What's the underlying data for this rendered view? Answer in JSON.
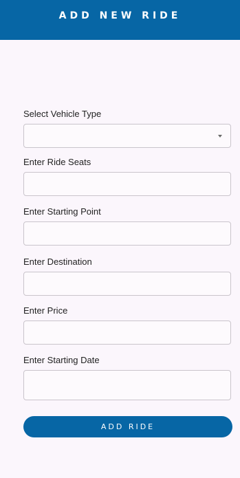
{
  "app_bar": {
    "title": "ADD NEW RIDE"
  },
  "form": {
    "vehicle_type": {
      "label": "Select Vehicle Type",
      "value": ""
    },
    "ride_seats": {
      "label": "Enter Ride Seats",
      "value": ""
    },
    "starting_point": {
      "label": "Enter Starting Point",
      "value": ""
    },
    "destination": {
      "label": "Enter Destination",
      "value": ""
    },
    "price": {
      "label": "Enter Price",
      "value": ""
    },
    "starting_date": {
      "label": "Enter Starting Date",
      "value": ""
    },
    "submit_label": "ADD RIDE"
  },
  "colors": {
    "primary": "#0766a5",
    "background": "#fbf6fc",
    "field_border": "#c9c4cb"
  }
}
